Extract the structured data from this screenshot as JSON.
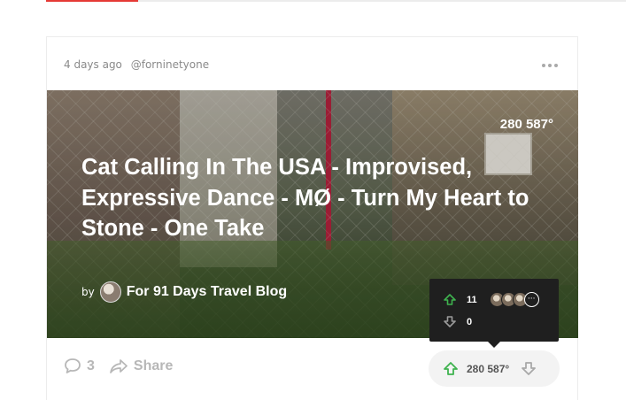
{
  "post": {
    "time_ago": "4 days ago",
    "author": "@forninetyone",
    "points": "280 587°",
    "title": "Cat Calling In The USA - Improvised, Expressive Dance - MØ - Turn My Heart to Stone - One Take",
    "by_label": "by",
    "source_name": "For 91 Days Travel Blog"
  },
  "vote_popup": {
    "upvotes": "11",
    "downvotes": "0",
    "more_icon_text": "···"
  },
  "footer": {
    "comments_count": "3",
    "share_label": "Share",
    "score": "280 587°"
  },
  "icons": {
    "upvote": "arrow-up-icon",
    "downvote": "arrow-down-icon",
    "comment": "comment-bubble-icon",
    "share": "share-arrow-icon",
    "more": "more-dots-icon"
  },
  "colors": {
    "accent_red": "#e53935",
    "upvote_green": "#3fb34f",
    "popup_bg": "#1f1f1f"
  }
}
